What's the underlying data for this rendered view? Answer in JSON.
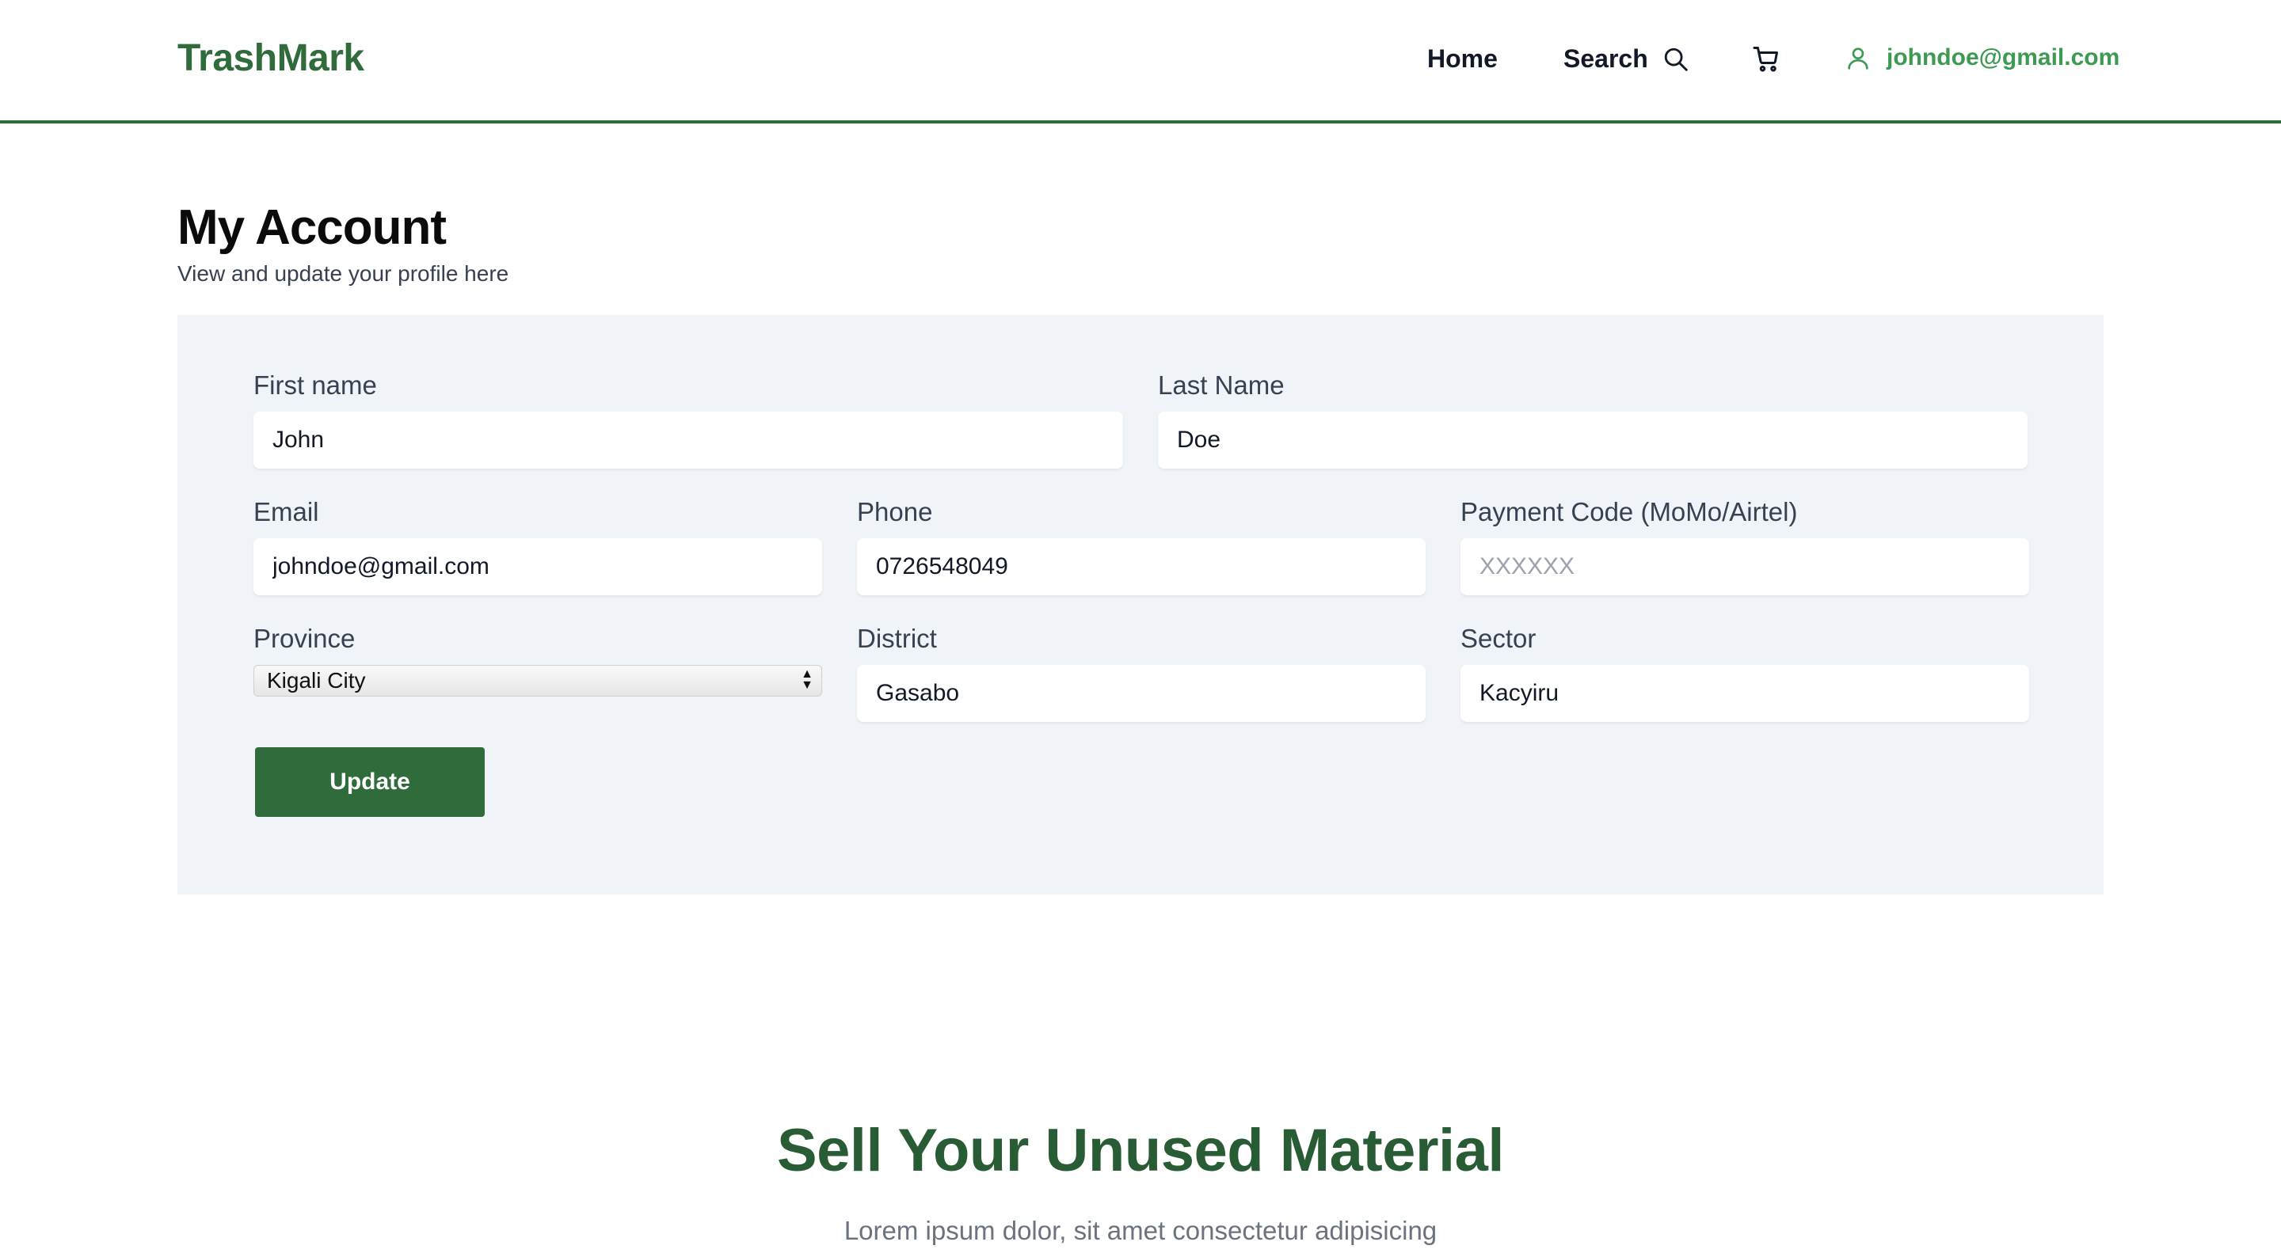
{
  "brand": {
    "name": "TrashMark",
    "color": "#2f6b3b"
  },
  "nav": {
    "home_label": "Home",
    "search_label": "Search",
    "search_icon": "search-icon",
    "cart_icon": "cart-icon",
    "user_icon": "user-icon",
    "user_email": "johndoe@gmail.com"
  },
  "page": {
    "title": "My Account",
    "subtitle": "View and update your profile here"
  },
  "form": {
    "first_name": {
      "label": "First name",
      "value": "John"
    },
    "last_name": {
      "label": "Last Name",
      "value": "Doe"
    },
    "email": {
      "label": "Email",
      "value": "johndoe@gmail.com"
    },
    "phone": {
      "label": "Phone",
      "value": "0726548049"
    },
    "payment_code": {
      "label": "Payment Code (MoMo/Airtel)",
      "value": "",
      "placeholder": "XXXXXX"
    },
    "province": {
      "label": "Province",
      "value": "Kigali City"
    },
    "district": {
      "label": "District",
      "value": "Gasabo"
    },
    "sector": {
      "label": "Sector",
      "value": "Kacyiru"
    },
    "submit_label": "Update"
  },
  "promo": {
    "title": "Sell Your Unused Material",
    "text": "Lorem ipsum dolor, sit amet consectetur adipisicing"
  },
  "colors": {
    "accent": "#2f6b3b",
    "user_link": "#3d9a52",
    "panel_bg": "#f0f4f8"
  }
}
